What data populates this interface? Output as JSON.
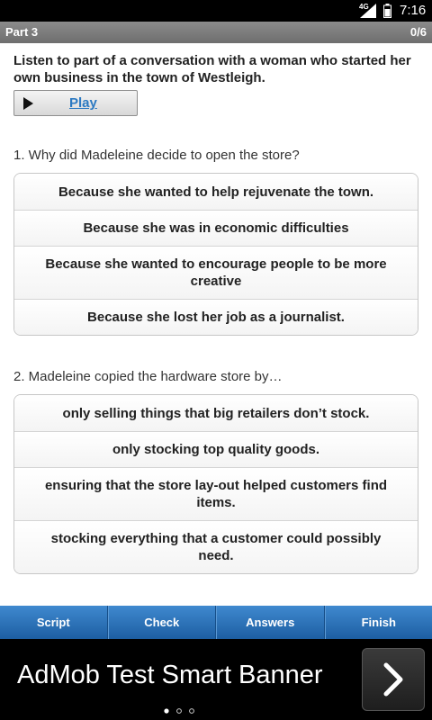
{
  "status": {
    "network": "4G",
    "time": "7:16"
  },
  "header": {
    "title": "Part 3",
    "progress": "0/6"
  },
  "intro": "Listen to part of a conversation with a woman who started her own business in the town of Westleigh.",
  "play_label": "Play",
  "questions": [
    {
      "text": "1. Why did Madeleine decide to open the store?",
      "options": [
        "Because she wanted to help rejuvenate the town.",
        "Because she was in economic difficulties",
        "Because she wanted to encourage people to be more creative",
        "Because she lost her job as a journalist."
      ]
    },
    {
      "text": "2. Madeleine copied the hardware store by…",
      "options": [
        "only selling things that big retailers don’t stock.",
        "only stocking top quality goods.",
        "ensuring that the store lay-out helped customers find items.",
        "stocking everything that a customer could possibly need."
      ]
    }
  ],
  "tabs": [
    "Script",
    "Check",
    "Answers",
    "Finish"
  ],
  "ad": {
    "text": "AdMob Test Smart Banner"
  },
  "colors": {
    "tab_bar": "#2f78c0",
    "play_link": "#2b79c2",
    "title_bar": "#7d7d7d"
  },
  "icons": [
    "signal-icon",
    "battery-icon",
    "play-icon",
    "chevron-right-icon"
  ]
}
